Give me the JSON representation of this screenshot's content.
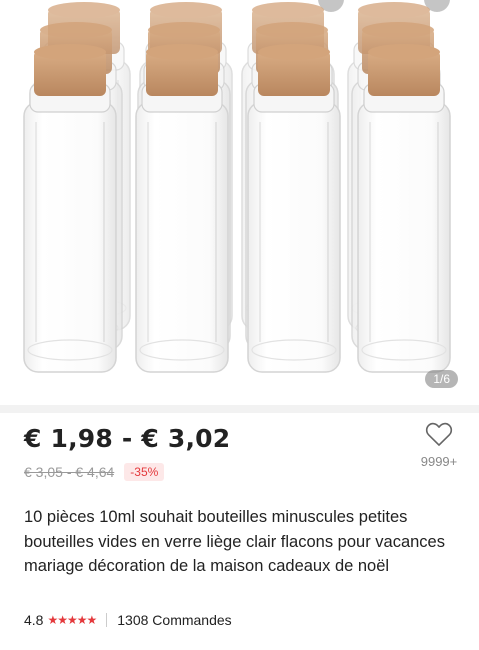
{
  "gallery": {
    "image_alt": "10 glass bottles with cork stoppers",
    "counter": "1/6"
  },
  "price": {
    "current": "€ 1,98 - € 3,02",
    "original": "€ 3,05 - € 4,64",
    "discount": "-35%"
  },
  "wishlist": {
    "count": "9999+"
  },
  "product": {
    "title": "10 pièces 10ml souhait bouteilles minuscules petites bouteilles vides en verre liège clair flacons pour vacances mariage décoration de la maison cadeaux de noël"
  },
  "rating": {
    "score": "4.8",
    "stars": "★★★★★",
    "orders": "1308 Commandes"
  },
  "colors": {
    "accent": "#e4393c",
    "cork": "#c89a72",
    "text": "#222222",
    "muted": "#999999"
  },
  "icons": [
    "heart-icon",
    "star-icon"
  ]
}
